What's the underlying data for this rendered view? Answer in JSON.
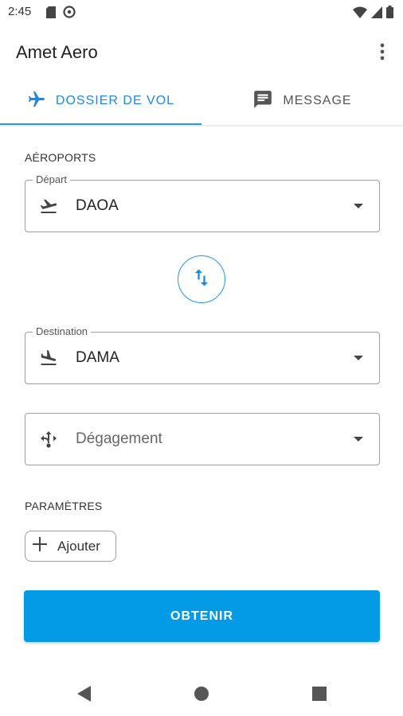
{
  "status_bar": {
    "time": "2:45"
  },
  "app": {
    "title": "Amet Aero"
  },
  "tabs": [
    {
      "label": "DOSSIER DE VOL",
      "icon": "airplane-icon",
      "active": true
    },
    {
      "label": "MESSAGE",
      "icon": "message-icon",
      "active": false
    }
  ],
  "airports": {
    "section_label": "AÉROPORTS",
    "departure": {
      "label": "Départ",
      "value": "DAOA",
      "icon": "flight-takeoff-icon"
    },
    "destination": {
      "label": "Destination",
      "value": "DAMA",
      "icon": "flight-land-icon"
    },
    "alternate": {
      "placeholder": "Dégagement",
      "icon": "alternate-route-icon"
    }
  },
  "parameters": {
    "section_label": "PARAMÈTRES",
    "add_label": "Ajouter"
  },
  "submit_label": "OBTENIR",
  "colors": {
    "accent": "#2196f3",
    "primary_button": "#039be5"
  }
}
